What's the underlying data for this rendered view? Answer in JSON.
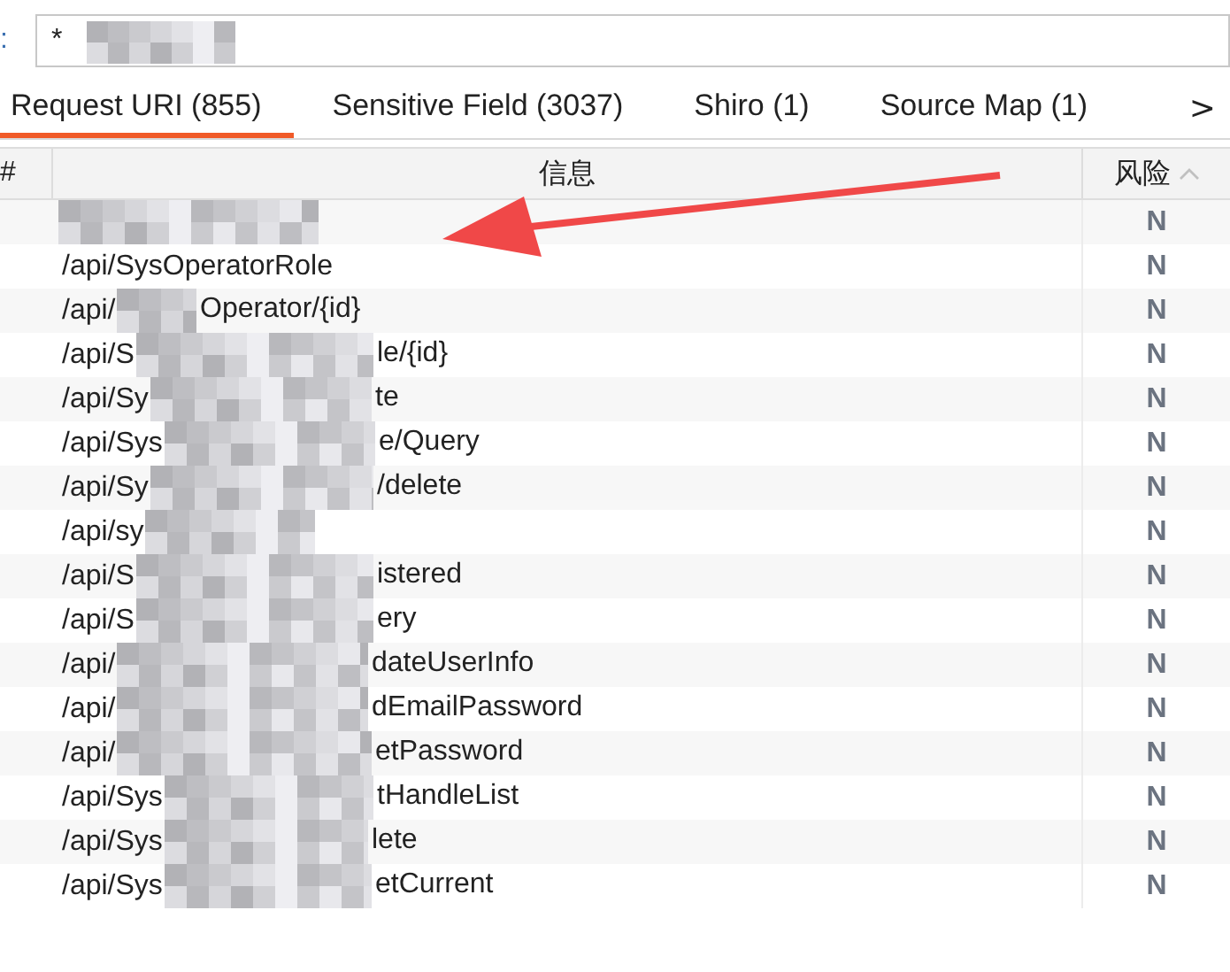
{
  "filter": {
    "label": ":",
    "value": "*"
  },
  "tabs": [
    {
      "label": "Request URI (855)",
      "selected": true
    },
    {
      "label": "Sensitive Field (3037)",
      "selected": false
    },
    {
      "label": "Shiro (1)",
      "selected": false
    },
    {
      "label": "Source Map (1)",
      "selected": false
    }
  ],
  "tab_scroll": ">",
  "table": {
    "columns": [
      {
        "label": "#",
        "sorted": false
      },
      {
        "label": "信息",
        "sorted": false
      },
      {
        "label": "风险",
        "sorted": true
      }
    ],
    "rows": [
      {
        "risk": "N"
      },
      {
        "info": "/api/SysOperatorRole",
        "risk": "N"
      },
      {
        "info": "/api/",
        "info_end": "Operator/{id}",
        "risk": "N"
      },
      {
        "info": "/api/S",
        "info_end": "le/{id}",
        "risk": "N"
      },
      {
        "info": "/api/Sy",
        "info_end": "te",
        "risk": "N"
      },
      {
        "info": "/api/Sys",
        "info_end": "e/Query",
        "risk": "N"
      },
      {
        "info": "/api/Sy",
        "info_end": "/delete",
        "risk": "N"
      },
      {
        "info": "/api/sy",
        "risk": "N"
      },
      {
        "info": "/api/S",
        "info_end": "istered",
        "risk": "N"
      },
      {
        "info": "/api/S",
        "info_end": "ery",
        "risk": "N"
      },
      {
        "info": "/api/",
        "info_end": "dateUserInfo",
        "risk": "N"
      },
      {
        "info": "/api/",
        "info_end": "dEmailPassword",
        "risk": "N"
      },
      {
        "info": "/api/",
        "info_end": "etPassword",
        "risk": "N"
      },
      {
        "info": "/api/Sys",
        "info_end": "tHandleList",
        "risk": "N"
      },
      {
        "info": "/api/Sys",
        "info_end": "lete",
        "risk": "N"
      },
      {
        "info": "/api/Sys",
        "info_end": "etCurrent",
        "risk": "N"
      }
    ]
  }
}
